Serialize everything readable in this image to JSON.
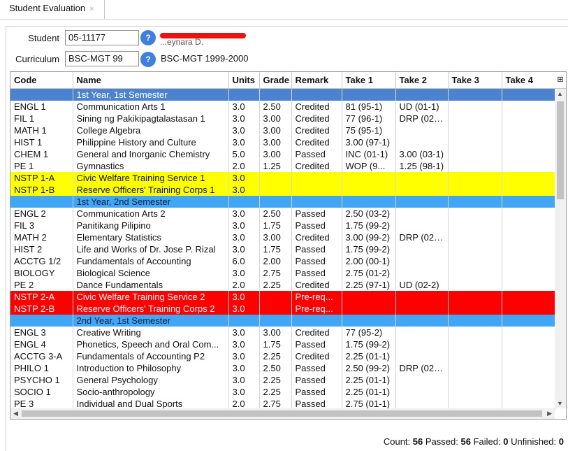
{
  "tab": {
    "title": "Student Evaluation",
    "close": "×"
  },
  "form": {
    "student_label": "Student",
    "student_id": "05-11177",
    "student_name_fragment": "...eynara D.",
    "curriculum_label": "Curriculum",
    "curriculum_code": "BSC-MGT 99",
    "curriculum_desc": "BSC-MGT 1999-2000",
    "help_glyph": "?"
  },
  "columns": [
    "Code",
    "Name",
    "Units",
    "Grade",
    "Remark",
    "Take 1",
    "Take 2",
    "Take 3",
    "Take 4"
  ],
  "rows": [
    {
      "type": "header",
      "cls": "first",
      "name": "1st Year, 1st Semester"
    },
    {
      "cells": [
        "ENGL 1",
        "Communication Arts 1",
        "3.0",
        "2.50",
        "Credited",
        "81 (95-1)",
        "UD (01-1)",
        "",
        ""
      ]
    },
    {
      "cells": [
        "FIL 1",
        "Sining ng Pakikipagtalastasan 1",
        "3.0",
        "3.00",
        "Credited",
        "77 (96-1)",
        "DRP (02-1)",
        "",
        ""
      ]
    },
    {
      "cells": [
        "MATH 1",
        "College Algebra",
        "3.0",
        "3.00",
        "Credited",
        "75 (95-1)",
        "",
        "",
        ""
      ]
    },
    {
      "cells": [
        "HIST 1",
        "Philippine History and Culture",
        "3.0",
        "3.00",
        "Credited",
        "3.00 (97-1)",
        "",
        "",
        ""
      ]
    },
    {
      "cells": [
        "CHEM 1",
        "General and Inorganic Chemistry",
        "5.0",
        "3.00",
        "Passed",
        "INC (01-1)",
        "3.00 (03-1)",
        "",
        ""
      ]
    },
    {
      "cells": [
        "PE 1",
        "Gymnastics",
        "2.0",
        "1.25",
        "Credited",
        "WOP (9...",
        "1.25 (98-1)",
        "",
        ""
      ]
    },
    {
      "type": "yellow",
      "cells": [
        "NSTP 1-A",
        "Civic Welfare Training Service 1",
        "3.0",
        "",
        "",
        "",
        "",
        "",
        ""
      ]
    },
    {
      "type": "yellow",
      "cells": [
        "NSTP 1-B",
        "Reserve Officers' Training Corps 1",
        "3.0",
        "",
        "",
        "",
        "",
        "",
        ""
      ]
    },
    {
      "type": "header",
      "name": "1st Year, 2nd Semester"
    },
    {
      "cells": [
        "ENGL 2",
        "Communication Arts 2",
        "3.0",
        "2.50",
        "Passed",
        "2.50 (03-2)",
        "",
        "",
        ""
      ]
    },
    {
      "cells": [
        "FIL 3",
        "Panitikang Pilipino",
        "3.0",
        "1.75",
        "Passed",
        "1.75 (99-2)",
        "",
        "",
        ""
      ]
    },
    {
      "cells": [
        "MATH 2",
        "Elementary Statistics",
        "3.0",
        "3.00",
        "Credited",
        "3.00 (99-2)",
        "DRP (02-1)",
        "",
        ""
      ]
    },
    {
      "cells": [
        "HIST 2",
        "Life and Works of Dr. Jose P. Rizal",
        "3.0",
        "1.75",
        "Passed",
        "1.75 (99-2)",
        "",
        "",
        ""
      ]
    },
    {
      "cells": [
        "ACCTG 1/2",
        "Fundamentals of Accounting",
        "6.0",
        "2.00",
        "Passed",
        "2.00 (00-1)",
        "",
        "",
        ""
      ]
    },
    {
      "cells": [
        "BIOLOGY",
        "Biological Science",
        "3.0",
        "2.75",
        "Passed",
        "2.75 (01-2)",
        "",
        "",
        ""
      ]
    },
    {
      "cells": [
        "PE 2",
        "Dance Fundamentals",
        "2.0",
        "2.25",
        "Credited",
        "2.25 (97-1)",
        "UD (02-2)",
        "",
        ""
      ]
    },
    {
      "type": "red",
      "cells": [
        "NSTP 2-A",
        "Civic Welfare Training Service 2",
        "3.0",
        "",
        "Pre-req...",
        "",
        "",
        "",
        ""
      ]
    },
    {
      "type": "red",
      "cells": [
        "NSTP 2-B",
        "Reserve Officers' Training Corps 2",
        "3.0",
        "",
        "Pre-req...",
        "",
        "",
        "",
        ""
      ]
    },
    {
      "type": "header",
      "name": "2nd Year, 1st Semester"
    },
    {
      "cells": [
        "ENGL 3",
        "Creative Writing",
        "3.0",
        "3.00",
        "Credited",
        "77 (95-2)",
        "",
        "",
        ""
      ]
    },
    {
      "cells": [
        "ENGL 4",
        "Phonetics, Speech and Oral Com...",
        "3.0",
        "1.75",
        "Passed",
        "1.75 (99-2)",
        "",
        "",
        ""
      ]
    },
    {
      "cells": [
        "ACCTG 3-A",
        "Fundamentals of Accounting P2",
        "3.0",
        "2.25",
        "Credited",
        "2.25 (01-1)",
        "",
        "",
        ""
      ]
    },
    {
      "cells": [
        "PHILO 1",
        "Introduction to Philosophy",
        "3.0",
        "2.50",
        "Passed",
        "2.50 (99-2)",
        "DRP (02-1)",
        "",
        ""
      ]
    },
    {
      "cells": [
        "PSYCHO 1",
        "General Psychology",
        "3.0",
        "2.25",
        "Passed",
        "2.25 (01-1)",
        "",
        "",
        ""
      ]
    },
    {
      "cells": [
        "SOCIO 1",
        "Socio-anthropology",
        "3.0",
        "2.25",
        "Passed",
        "2.25 (01-1)",
        "",
        "",
        ""
      ]
    },
    {
      "cells": [
        "PE 3",
        "Individual and Dual Sports",
        "2.0",
        "2.75",
        "Passed",
        "2.75 (01-1)",
        "",
        "",
        ""
      ]
    }
  ],
  "status": {
    "count_label": "Count:",
    "count": "56",
    "passed_label": "Passed:",
    "passed": "56",
    "failed_label": "Failed:",
    "failed": "0",
    "unfinished_label": "Unfinished:",
    "unfinished": "0"
  }
}
